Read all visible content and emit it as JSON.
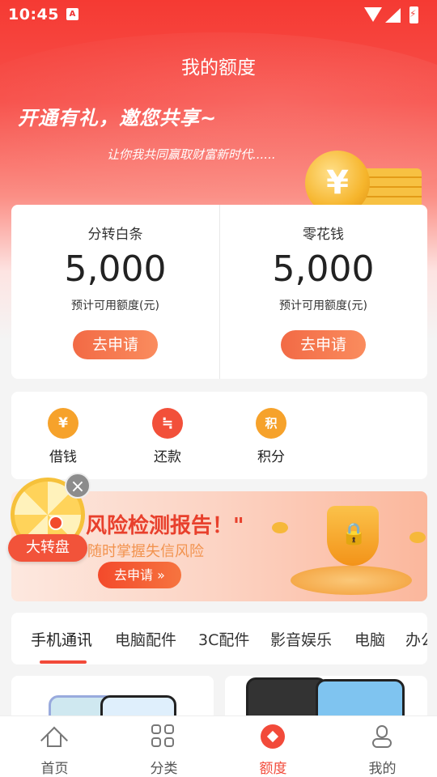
{
  "status_bar": {
    "time": "10:45",
    "app_badge": "A"
  },
  "header": {
    "title": "我的额度",
    "slogan": "开通有礼，邀您共享~",
    "subtitle": "让你我共同赢取财富新时代......",
    "coin_symbol": "¥"
  },
  "credit": {
    "products": [
      {
        "name": "分转白条",
        "amount": "5,000",
        "note": "预计可用额度(元)",
        "button": "去申请"
      },
      {
        "name": "零花钱",
        "amount": "5,000",
        "note": "预计可用额度(元)",
        "button": "去申请"
      }
    ]
  },
  "quick_actions": [
    {
      "label": "借钱",
      "icon": "borrow-money-icon",
      "glyph": "¥",
      "color": "#f6a22b"
    },
    {
      "label": "还款",
      "icon": "repay-bag-icon",
      "glyph": "≒",
      "color": "#f2503a"
    },
    {
      "label": "积分",
      "icon": "points-icon",
      "glyph": "积",
      "color": "#f6a22b"
    }
  ],
  "promo": {
    "title": "风险检测报告！\"",
    "subtitle": "随时掌握失信风险",
    "button": "去申请 »"
  },
  "wheel": {
    "label": "大转盘",
    "close": "×"
  },
  "categories": {
    "tabs": [
      "手机通讯",
      "电脑配件",
      "3C配件",
      "影音娱乐",
      "电脑",
      "办公"
    ],
    "active_index": 0
  },
  "bottom_nav": {
    "items": [
      {
        "label": "首页",
        "icon": "home-icon"
      },
      {
        "label": "分类",
        "icon": "category-grid-icon"
      },
      {
        "label": "额度",
        "icon": "quota-icon"
      },
      {
        "label": "我的",
        "icon": "profile-icon"
      }
    ],
    "active_index": 2
  },
  "colors": {
    "primary": "#f24a3a",
    "accent_orange": "#fa8c5e",
    "gold": "#f6b52c"
  }
}
